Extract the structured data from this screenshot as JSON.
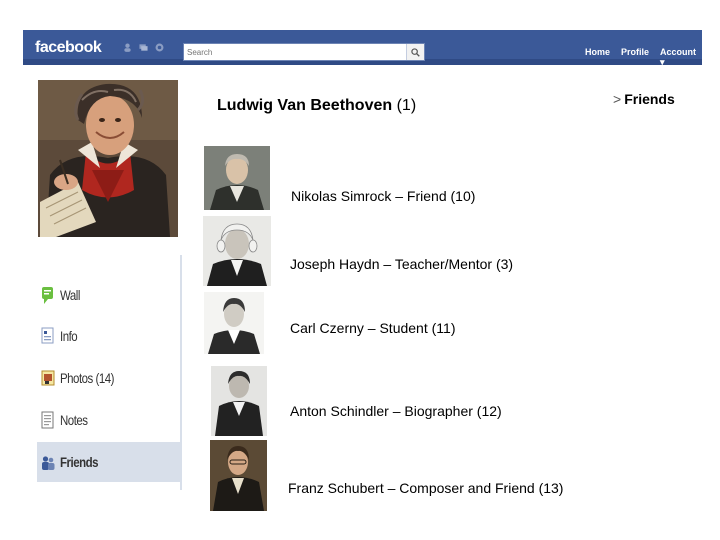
{
  "topbar": {
    "logo": "facebook",
    "search_placeholder": "Search",
    "nav": [
      "Home",
      "Profile",
      "Account ▾"
    ],
    "brand_color": "#3b5998"
  },
  "profile": {
    "name": "Ludwig Van Beethoven",
    "count": "(1)"
  },
  "section": {
    "arrow": ">",
    "title": "Friends"
  },
  "sidebar": {
    "items": [
      {
        "label": "Wall",
        "icon": "wall-icon"
      },
      {
        "label": "Info",
        "icon": "info-icon"
      },
      {
        "label": "Photos (14)",
        "icon": "photos-icon"
      },
      {
        "label": "Notes",
        "icon": "notes-icon"
      },
      {
        "label": "Friends",
        "icon": "friends-icon",
        "selected": true
      }
    ]
  },
  "friends": [
    {
      "text": "Nikolas Simrock – Friend (10)"
    },
    {
      "text": "Joseph Haydn – Teacher/Mentor (3)"
    },
    {
      "text": "Carl Czerny – Student (11)"
    },
    {
      "text": "Anton Schindler – Biographer (12)"
    },
    {
      "text": "Franz Schubert – Composer and Friend (13)"
    }
  ]
}
